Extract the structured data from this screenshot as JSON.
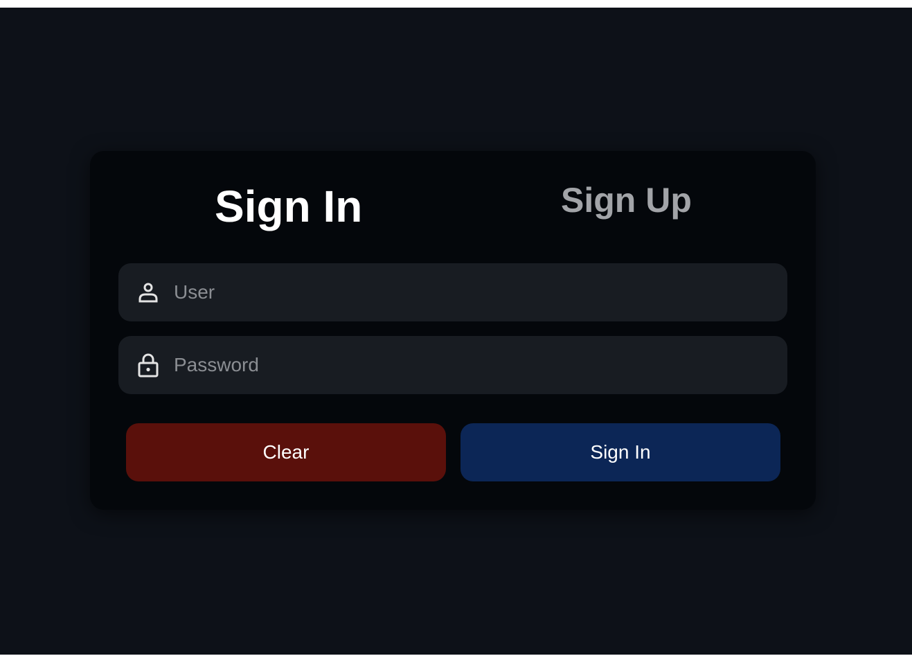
{
  "auth": {
    "tabs": {
      "sign_in": "Sign In",
      "sign_up": "Sign Up",
      "active": "sign_in"
    },
    "fields": {
      "user": {
        "value": "",
        "placeholder": "User",
        "icon": "user-icon"
      },
      "password": {
        "value": "",
        "placeholder": "Password",
        "icon": "lock-icon"
      }
    },
    "buttons": {
      "clear_label": "Clear",
      "submit_label": "Sign In"
    }
  },
  "colors": {
    "background": "#0d1118",
    "card": "#04070b",
    "field": "#181c22",
    "clear_button": "#5a100b",
    "submit_button": "#0c2656",
    "active_tab": "#ffffff",
    "inactive_tab": "#a2a4a8",
    "placeholder": "#8b8e93"
  }
}
